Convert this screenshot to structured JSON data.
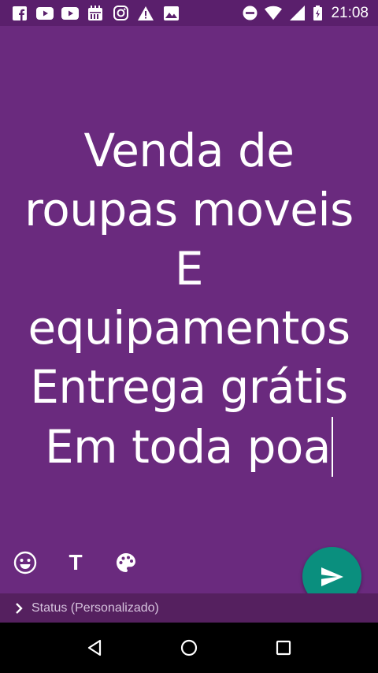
{
  "status_bar": {
    "time": "21:08",
    "left_icons": [
      "facebook-icon",
      "youtube-icon",
      "youtube-icon",
      "calendar-app-icon",
      "instagram-icon",
      "warning-icon",
      "image-icon"
    ],
    "right_icons": [
      "do-not-disturb-icon",
      "wifi-icon",
      "cellular-signal-icon",
      "battery-icon"
    ]
  },
  "status": {
    "lines": [
      "Venda de",
      "roupas moveis",
      "E",
      "equipamentos",
      "Entrega grátis",
      "Em toda poa"
    ],
    "background_color": "#6a2a7e",
    "text_color": "#ffffff"
  },
  "tools": {
    "emoji_icon": "emoji-icon",
    "text_style_label": "T",
    "palette_icon": "palette-icon"
  },
  "send": {
    "icon": "send-icon",
    "color": "#0a8f7e"
  },
  "audience": {
    "label": "Status (Personalizado)"
  },
  "nav": {
    "back": "back-icon",
    "home": "home-icon",
    "recents": "recents-icon"
  }
}
